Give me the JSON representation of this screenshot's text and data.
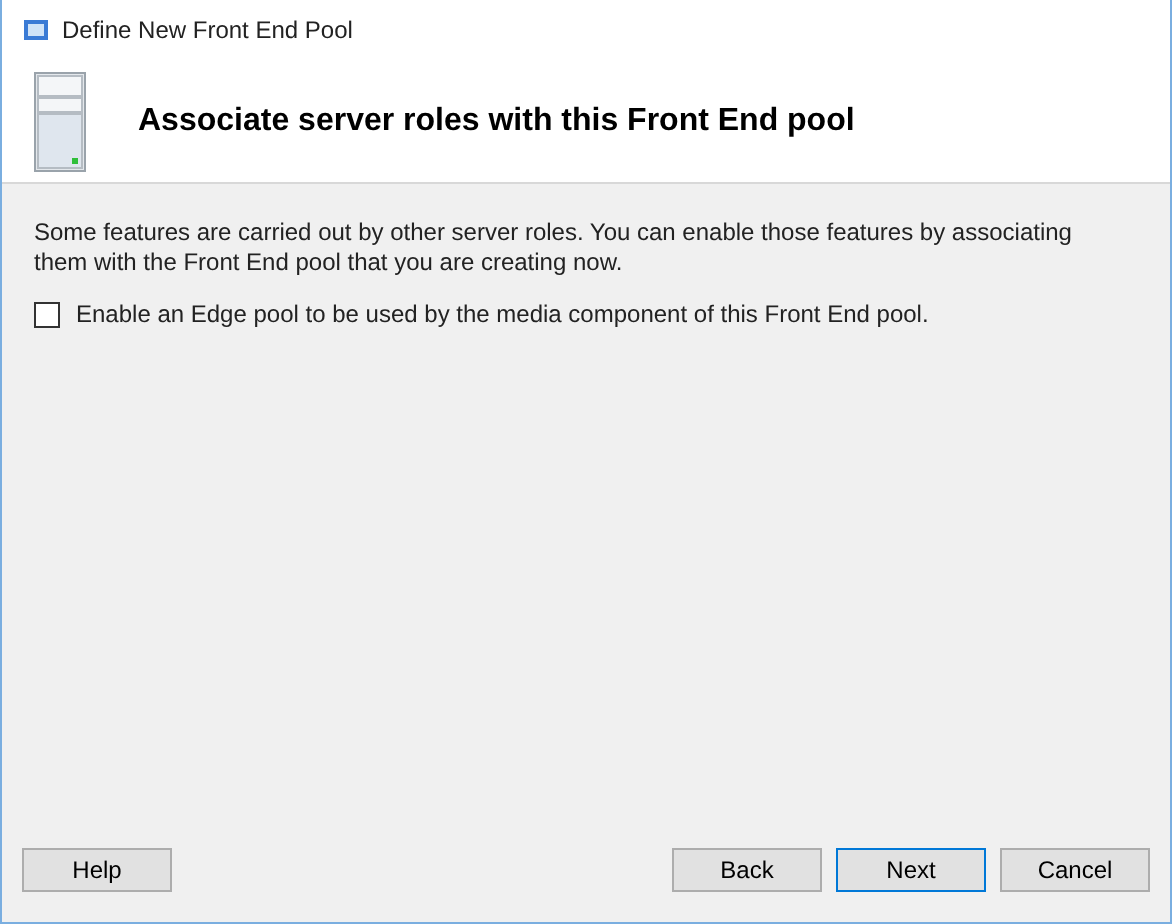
{
  "window": {
    "title": "Define New Front End Pool"
  },
  "header": {
    "title": "Associate server roles with this Front End pool"
  },
  "description": "Some features are carried out by other server roles. You can enable those features by associating them with the Front End pool that you are creating now.",
  "options": [
    {
      "label": "Enable an Edge pool to be used by the media component of this Front End pool.",
      "checked": false
    }
  ],
  "buttons": [
    {
      "label": "Help",
      "focused": false
    },
    {
      "label": "Back",
      "focused": false
    },
    {
      "label": "Next",
      "focused": true
    },
    {
      "label": "Cancel",
      "focused": false
    }
  ]
}
